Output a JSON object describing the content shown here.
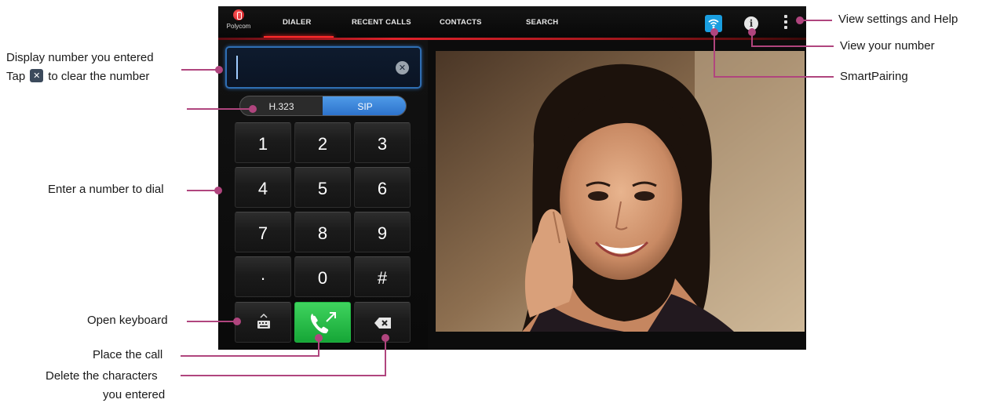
{
  "app": {
    "logo_text": "Polycom",
    "tabs": [
      {
        "label": "DIALER",
        "active": true
      },
      {
        "label": "RECENT CALLS",
        "active": false
      },
      {
        "label": "CONTACTS",
        "active": false
      },
      {
        "label": "SEARCH",
        "active": false
      }
    ],
    "icons": {
      "smartpairing": "smartpairing-icon",
      "info": "info-icon",
      "menu": "overflow-menu-icon"
    },
    "info_glyph": "i"
  },
  "dialer": {
    "number_value": "",
    "protocols": [
      "H.323",
      "SIP"
    ],
    "selected_protocol": "SIP",
    "keys": [
      "1",
      "2",
      "3",
      "4",
      "5",
      "6",
      "7",
      "8",
      "9",
      "·",
      "0",
      "#"
    ],
    "bottom_row": [
      {
        "name": "keyboard",
        "icon": "keyboard-icon"
      },
      {
        "name": "call",
        "icon": "phone-call-icon"
      },
      {
        "name": "delete",
        "icon": "backspace-icon"
      }
    ]
  },
  "video": {
    "subject": "remote participant video"
  },
  "callouts": {
    "display_number": "Display number you entered",
    "tap_prefix": "Tap",
    "tap_suffix": "to clear the number",
    "enter_number": "Enter a number to dial",
    "open_keyboard": "Open keyboard",
    "place_call": "Place the call",
    "delete_line1": "Delete the characters",
    "delete_line2": "you entered",
    "settings_help": "View settings and Help",
    "your_number": "View your number",
    "smartpairing": "SmartPairing"
  },
  "colors": {
    "accent_red": "#e0222a",
    "callout_line": "#b0457e",
    "sip_blue": "#2a6fc9",
    "call_green": "#16a637",
    "pairing_blue": "#1a9ee0"
  }
}
